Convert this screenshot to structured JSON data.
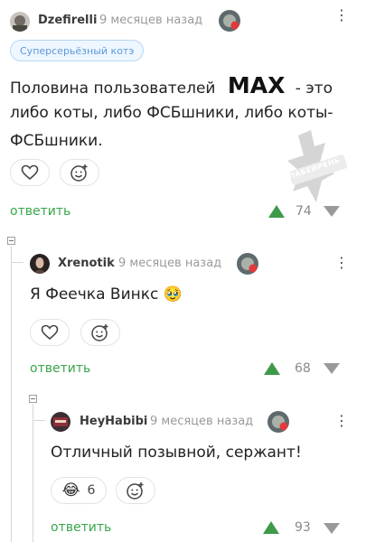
{
  "comments": [
    {
      "username": "Dzefirelli",
      "time": "9 месяцев назад",
      "tag": "Суперсерьёзный котэ",
      "text_before": "Половина пользователей",
      "text_big": "MAX",
      "text_line1_after": "- это",
      "text_line2": "либо коты, либо ФСБшники, либо коты-",
      "text_line3": "ФСБшники.",
      "reply_label": "ответить",
      "score": "74",
      "sticker_caption": "ПАБЕЙРЕНЬ"
    },
    {
      "username": "Xrenotik",
      "time": "9 месяцев назад",
      "text": "Я Феечка Винкс 🥹",
      "reply_label": "ответить",
      "score": "68"
    },
    {
      "username": "HeyHabibi",
      "time": "9 месяцев назад",
      "text": "Отличный позывной, сержант!",
      "reaction_emoji": "😂",
      "reaction_count": "6",
      "reply_label": "ответить",
      "score": "93"
    }
  ],
  "colors": {
    "accent_green": "#39a64b",
    "tag_blue": "#5b9ad8",
    "muted": "#9a9a9a"
  },
  "icons": [
    "heart-icon",
    "add-emoji-icon",
    "upvote-icon",
    "downvote-icon",
    "more-options-icon",
    "collapse-thread-icon"
  ]
}
